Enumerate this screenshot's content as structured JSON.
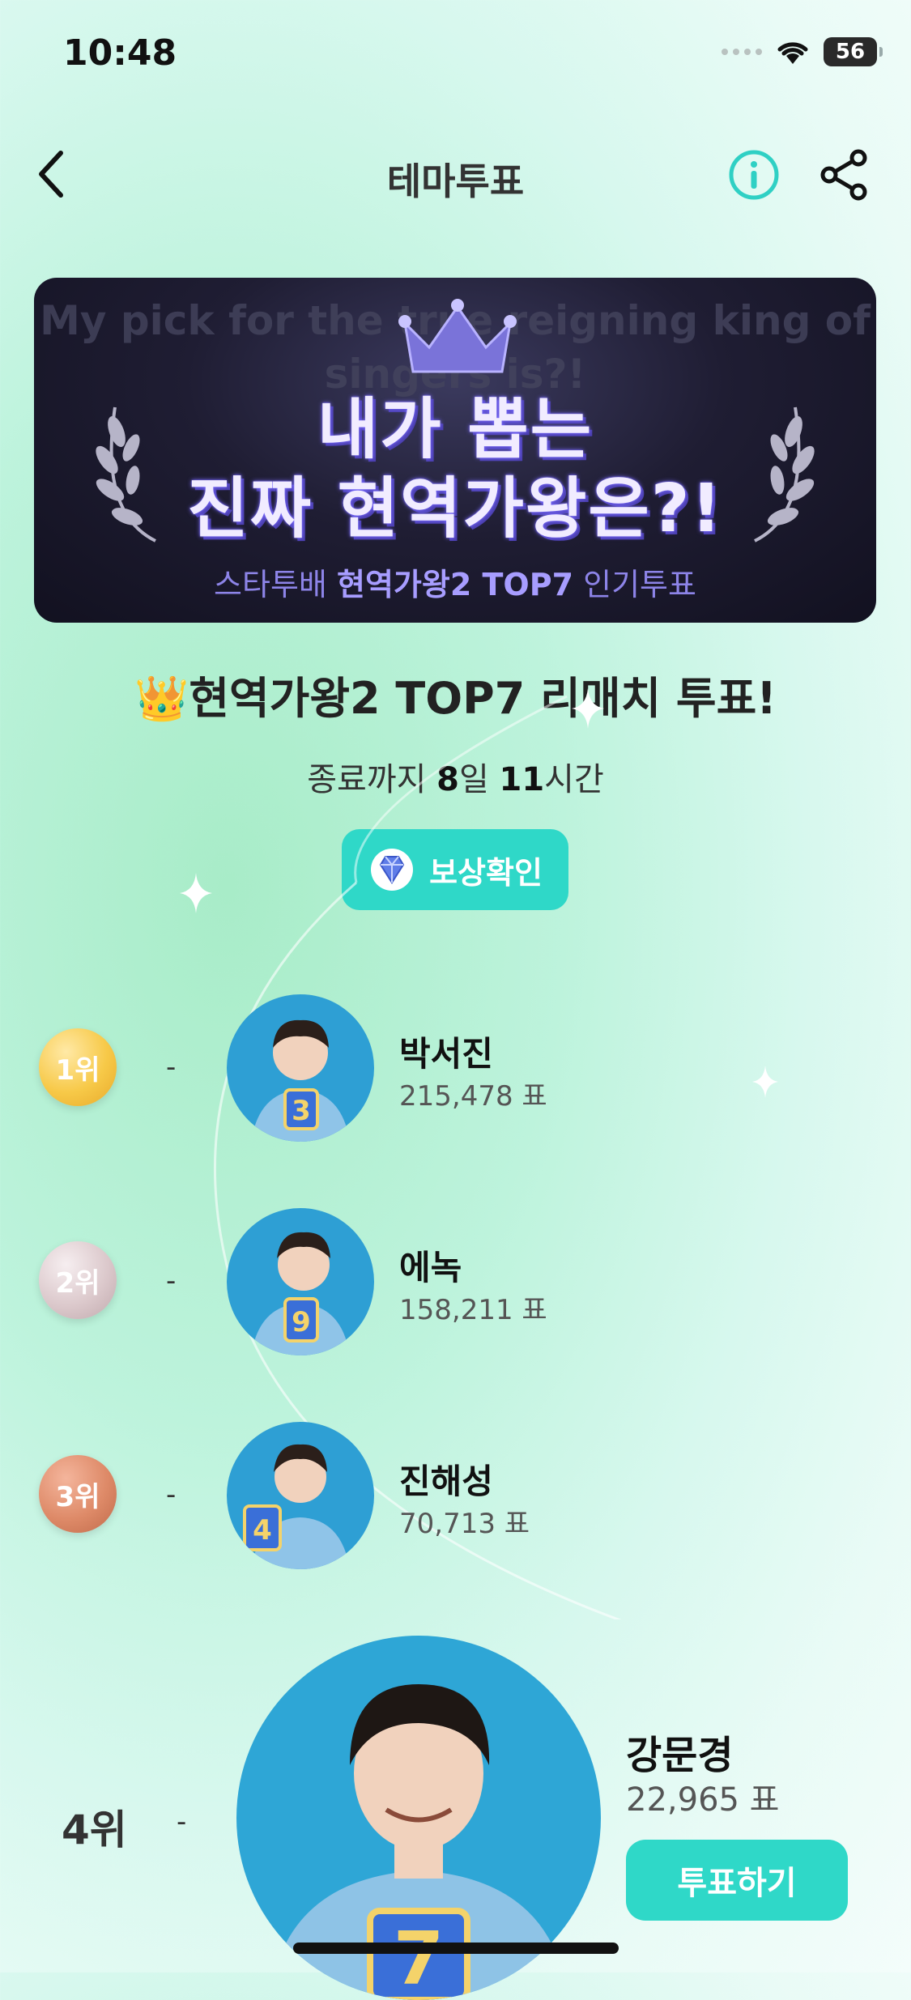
{
  "status_bar": {
    "time": "10:48",
    "battery": "56"
  },
  "header": {
    "title": "테마투표"
  },
  "banner": {
    "bg_text": "My pick for the true reigning king of singers is?!",
    "line1": "내가 뽑는",
    "line2": "진짜 현역가왕은?!",
    "sub_prefix": "스타투배",
    "sub_bold": "현역가왕2 TOP7",
    "sub_suffix": "인기투표"
  },
  "vote": {
    "heading": "현역가왕2 TOP7 리매치 투표!",
    "countdown_prefix": "종료까지",
    "countdown_days": "8",
    "countdown_days_unit": "일",
    "countdown_hours": "11",
    "countdown_hours_unit": "시간",
    "reward_label": "보상확인"
  },
  "ranking": [
    {
      "rank": "1위",
      "change": "-",
      "name": "박서진",
      "votes": "215,478 표",
      "badge_color": "#f7c948"
    },
    {
      "rank": "2위",
      "change": "-",
      "name": "에녹",
      "votes": "158,211 표",
      "badge_color": "#dcc9cc"
    },
    {
      "rank": "3위",
      "change": "-",
      "name": "진해성",
      "votes": "70,713 표",
      "badge_color": "#de8a68"
    },
    {
      "rank": "4위",
      "change": "-",
      "name": "강문경",
      "votes": "22,965 표"
    }
  ],
  "vote_button": "투표하기",
  "colors": {
    "accent": "#2fd8c8",
    "banner_bg": "#1f1d33"
  }
}
